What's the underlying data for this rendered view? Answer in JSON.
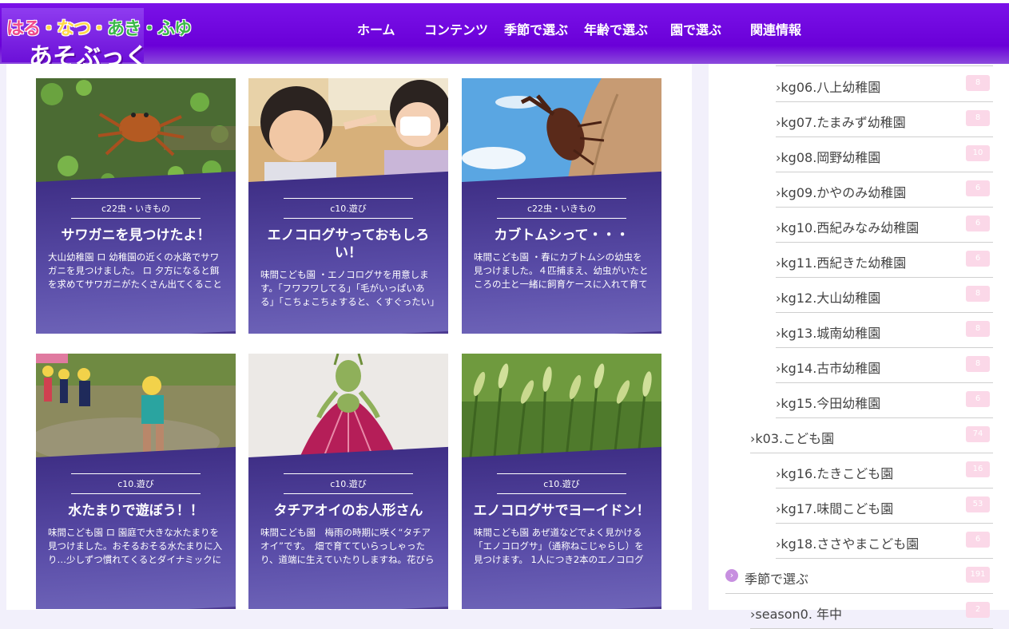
{
  "logo": {
    "line1_a": "はる",
    "line1_b": "・なつ・",
    "line1_c": "あき・ふゆ",
    "line2": "あそぶっく"
  },
  "nav": [
    {
      "label": "ホーム"
    },
    {
      "label": "コンテンツ"
    },
    {
      "label": "季節で選ぶ"
    },
    {
      "label": "年齢で選ぶ"
    },
    {
      "label": "園で選ぶ"
    },
    {
      "label": "関連情報"
    }
  ],
  "cards": [
    {
      "category": "c22虫・いきもの",
      "title": "サワガニを見つけたよ！",
      "excerpt": "大山幼稚園 ロ 幼稚園の近くの水路でサワガニを見つけました。 ロ 夕方になると餌を求めてサワガニがたくさん出てくることを教えてもらいました。"
    },
    {
      "category": "c10.遊び",
      "title": "エノコログサっておもしろい！",
      "excerpt": "味間こども園 ・エノコログサを用意します。「フワフワしてる」「毛がいっぱいある」「こちょこちょすると、くすぐったい」など様々な反応が見られました。"
    },
    {
      "category": "c22虫・いきもの",
      "title": "カブトムシって・・・",
      "excerpt": "味間こども園 ・春にカブトムシの幼虫を見つけました。４匹捕まえ、幼虫がいたところの土と一緒に飼育ケースに入れて育てました。"
    },
    {
      "category": "c10.遊び",
      "title": "水たまりで遊ぼう！！",
      "excerpt": "味間こども園 ロ 園庭で大きな水たまりを見つけました。おそるおそる水たまりに入り…少しずつ慣れてくるとダイナミックに遊び始めました。"
    },
    {
      "category": "c10.遊び",
      "title": "タチアオイのお人形さん",
      "excerpt": "味間こども園　梅雨の時期に咲く“タチアオイ”です。　畑で育てていらっしゃったり、道端に生えていたりしますね。花びらを使ってお人形を作ります。"
    },
    {
      "category": "c10.遊び",
      "title": "エノコログサでヨーイドン！",
      "excerpt": "味間こども園 あぜ道などでよく見かける「エノコログサ」（通称ねこじゃらし）を見つけます。 1人につき2本のエノコログサを用意し、穂の先を合わせます。"
    }
  ],
  "sidebar": [
    {
      "label": "kg06.八上幼稚園",
      "count": "8"
    },
    {
      "label": "kg07.たまみず幼稚園",
      "count": "8"
    },
    {
      "label": "kg08.岡野幼稚園",
      "count": "10"
    },
    {
      "label": "kg09.かやのみ幼稚園",
      "count": "6"
    },
    {
      "label": "kg10.西紀みなみ幼稚園",
      "count": "6"
    },
    {
      "label": "kg11.西紀きた幼稚園",
      "count": "6"
    },
    {
      "label": "kg12.大山幼稚園",
      "count": "8"
    },
    {
      "label": "kg13.城南幼稚園",
      "count": "8"
    },
    {
      "label": "kg14.古市幼稚園",
      "count": "8"
    },
    {
      "label": "kg15.今田幼稚園",
      "count": "6"
    },
    {
      "label": "k03.こども園",
      "count": "74"
    },
    {
      "label": "kg16.たきこども園",
      "count": "16"
    },
    {
      "label": "kg17.味間こども園",
      "count": "53"
    },
    {
      "label": "kg18.ささやまこども園",
      "count": "6"
    },
    {
      "label": "季節で選ぶ",
      "count": "191"
    },
    {
      "label": "season0. 年中",
      "count": "2"
    }
  ],
  "colors": {
    "header": "#6a00d8",
    "card": "#4c3a91",
    "badge": "#fbd8e8"
  }
}
